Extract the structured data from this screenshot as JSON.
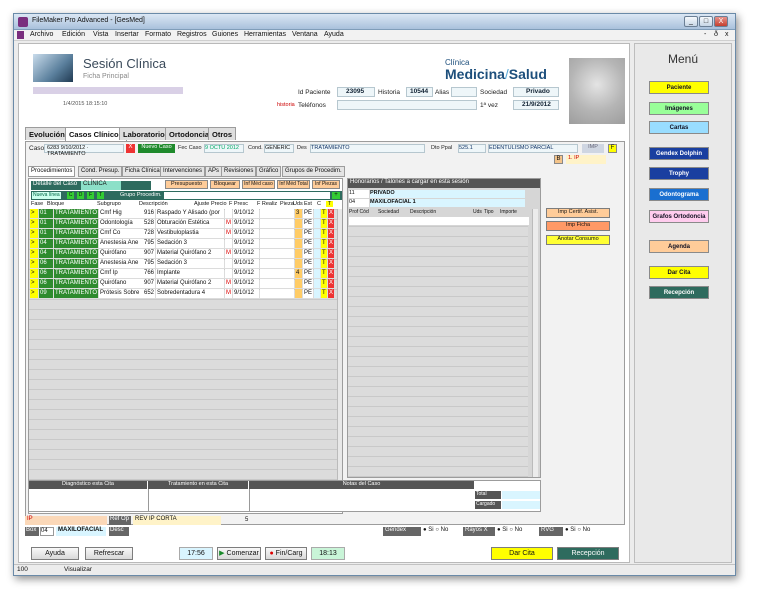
{
  "window": {
    "title": "FileMaker Pro Advanced - [GesMed]",
    "min": "_",
    "max": "□",
    "close": "X"
  },
  "menu": [
    "Archivo",
    "Edición",
    "Vista",
    "Insertar",
    "Formato",
    "Registros",
    "Guiones",
    "Herramientas",
    "Ventana",
    "Ayuda"
  ],
  "menu_controls": [
    "-",
    "ð",
    "x"
  ],
  "header": {
    "title": "Sesión Clínica",
    "subtitle": "Ficha Principal",
    "timestamp": "1/4/2015 18:15:10",
    "historia_tag": "historia",
    "id_paciente_label": "Id Paciente",
    "id_paciente": "23095",
    "historia_label": "Historia",
    "historia": "10544",
    "alias_label": "Alias",
    "sociedad_label": "Sociedad",
    "sociedad": "Privado",
    "telefonos_label": "Teléfonos",
    "primera_vez_label": "1ª vez",
    "primera_vez": "21/9/2012",
    "logo_top": "Clínica",
    "logo_main": "Medicina",
    "logo_sep": "/",
    "logo_end": "Salud"
  },
  "main_tabs": [
    "Evolución",
    "Casos Clínicos",
    "Laboratorio",
    "Ortodoncia",
    "Otros"
  ],
  "caso": {
    "caso_label": "Caso",
    "caso_value": "6283 9/10/2012 · TRATAMIENTO",
    "x": "X",
    "nuevo": "Nuevo Caso",
    "fec_label": "Fec Caso",
    "fec_value": "9 OCTU 2012",
    "cond_label": "Cond.",
    "cond_value": "GENERIC",
    "des_label": "Des",
    "des_value": "TRATAMIENTO",
    "dto_label": "Dto Ppal",
    "dto_code": "525.1",
    "dto_value": "EDENTULISMO PARCIAL",
    "imp": "IMP",
    "f": "F",
    "b": "B",
    "ip": "1. IP"
  },
  "sub_tabs": [
    "Procedimientos",
    "Cond. Presup.",
    "Ficha Clínica",
    "Intervenciones",
    "APs",
    "Revisiones",
    "Gráfico",
    "Grupos de Procedim."
  ],
  "detalle": {
    "title": "Detalle del Caso",
    "clinica": "CLÍNICA",
    "nueva_linea": "Nueva línea",
    "c": "C",
    "d": "D",
    "f": "F",
    "t": "T",
    "grupo": "Grupo Procedim.",
    "plus": "+",
    "presupuesto": "Presupuesto",
    "bloquear": "Bloquear",
    "inf_med_caso": "Inf Méd caso",
    "inf_med_total": "Inf Méd Total",
    "inf_piezas": "Inf Piezas"
  },
  "cols": [
    "Fase",
    "Bloque",
    "Subgrupo",
    "Descripción",
    "Ajuste",
    "Precio",
    "F Presc",
    "F Realiz",
    "Pieza",
    "Uds",
    "Est",
    "C",
    "T"
  ],
  "rows": [
    {
      "fase": "01",
      "bloque": "TRATAMIENTO",
      "sub": "Cmf Hig",
      "code": "916",
      "desc": "Raspado Y Alisado (por",
      "m": "",
      "fecha": "9/10/12",
      "uds": "3",
      "est": "PE"
    },
    {
      "fase": "01",
      "bloque": "TRATAMIENTO",
      "sub": "Odontología",
      "code": "528",
      "desc": "Obturación Estética",
      "m": "M",
      "fecha": "9/10/12",
      "uds": "",
      "est": "PE"
    },
    {
      "fase": "01",
      "bloque": "TRATAMIENTO",
      "sub": "Cmf Co",
      "code": "728",
      "desc": "Vestibuloplastia",
      "m": "M",
      "fecha": "9/10/12",
      "uds": "",
      "est": "PE"
    },
    {
      "fase": "04",
      "bloque": "TRATAMIENTO",
      "sub": "Anestesia Ane",
      "code": "795",
      "desc": "Sedación 3",
      "m": "",
      "fecha": "9/10/12",
      "uds": "",
      "est": "PE"
    },
    {
      "fase": "04",
      "bloque": "TRATAMIENTO",
      "sub": "Quirófano",
      "code": "907",
      "desc": "Material Quirófano 2",
      "m": "M",
      "fecha": "9/10/12",
      "uds": "",
      "est": "PE"
    },
    {
      "fase": "06",
      "bloque": "TRATAMIENTO",
      "sub": "Anestesia Ane",
      "code": "795",
      "desc": "Sedación 3",
      "m": "",
      "fecha": "9/10/12",
      "uds": "",
      "est": "PE"
    },
    {
      "fase": "06",
      "bloque": "TRATAMIENTO",
      "sub": "Cmf Ip",
      "code": "766",
      "desc": "Implante",
      "m": "",
      "fecha": "9/10/12",
      "uds": "4",
      "est": "PE"
    },
    {
      "fase": "06",
      "bloque": "TRATAMIENTO",
      "sub": "Quirófano",
      "code": "907",
      "desc": "Material Quirófano 2",
      "m": "M",
      "fecha": "9/10/12",
      "uds": "",
      "est": "PE"
    },
    {
      "fase": "09",
      "bloque": "TRATAMIENTO",
      "sub": "Prótesis Sobre",
      "code": "652",
      "desc": "Sobredentadura 4",
      "m": "M",
      "fecha": "9/10/12",
      "uds": "",
      "est": "PE"
    }
  ],
  "honorarios": {
    "title": "Honorarios / Talones a cargar en esta sesión",
    "n1": "11",
    "v1": "PRIVADO",
    "n2": "04",
    "v2": "MAXILOFACIAL 1",
    "cols": [
      "Prof Cód",
      "Sociedad",
      "Descripción",
      "Uds",
      "Tipo",
      "Importe"
    ],
    "imp_certif": "Imp Certif. Asist.",
    "imp_ficha": "Imp Ficha",
    "anotar": "Anotar Consumo"
  },
  "bottom_panels": {
    "diag": "Diagnóstico esta Cita",
    "trat": "Tratamiento en esta Cita",
    "notas": "Notas del Caso",
    "total": "Total",
    "cargado": "Cargado"
  },
  "ip_row": {
    "ip": "IP",
    "ref_op": "Ref Op",
    "ref_val": "REV IP CORTA",
    "num": "5",
    "box": "Box",
    "box_num": "04",
    "box_val": "MAXILOFACIAL",
    "desc": "Desc",
    "gendex": "Gendex",
    "rayos": "Rayos X",
    "rvg": "RVG",
    "si": "Si",
    "no": "No"
  },
  "footer": {
    "ayuda": "Ayuda",
    "refrescar": "Refrescar",
    "t1": "17:56",
    "comenzar": "Comenzar",
    "fin": "Fin/Carg",
    "t2": "18:13",
    "dar_cita": "Dar Cita",
    "recepcion": "Recepción"
  },
  "sidebar": {
    "title": "Menú",
    "items": [
      {
        "label": "Paciente",
        "color": "#ffff00"
      },
      {
        "label": "Imágenes",
        "color": "#99ff99"
      },
      {
        "label": "Cartas",
        "color": "#99ddff"
      },
      {
        "label": "Gendex Dolphin",
        "color": "#1a3fa0"
      },
      {
        "label": "Trophy",
        "color": "#1a3fa0"
      },
      {
        "label": "Odontograma",
        "color": "#1a6fd0"
      },
      {
        "label": "Grafos Ortodoncia",
        "color": "#ffccee"
      },
      {
        "label": "Agenda",
        "color": "#ffcc99"
      },
      {
        "label": "Dar Cita",
        "color": "#ffff00"
      },
      {
        "label": "Recepción",
        "color": "#2e6b5e"
      }
    ]
  },
  "status": {
    "zoom": "100",
    "mode": "Visualizar"
  }
}
